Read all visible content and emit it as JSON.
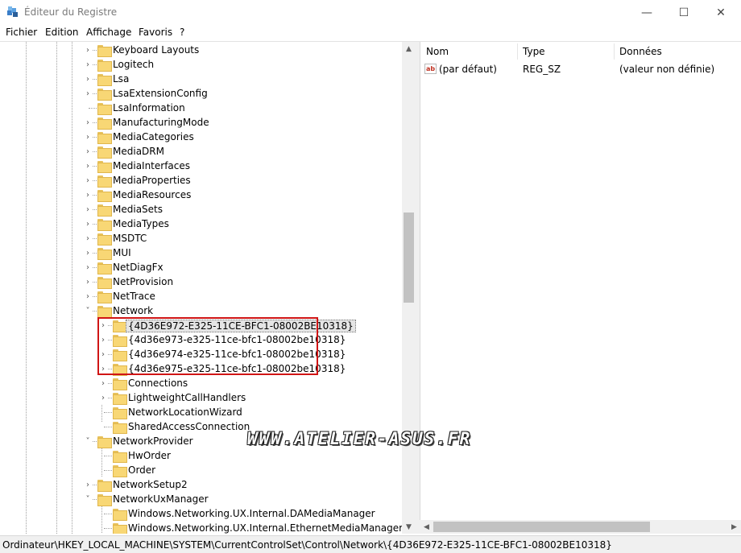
{
  "window": {
    "title": "Éditeur du Registre",
    "minimize_glyph": "—",
    "maximize_glyph": "☐",
    "close_glyph": "✕",
    "icon": "registry-icon"
  },
  "menu": [
    "Fichier",
    "Edition",
    "Affichage",
    "Favoris",
    "?"
  ],
  "tree": {
    "level1": [
      {
        "label": "Keyboard Layouts",
        "exp": "›"
      },
      {
        "label": "Logitech",
        "exp": "›"
      },
      {
        "label": "Lsa",
        "exp": "›"
      },
      {
        "label": "LsaExtensionConfig",
        "exp": "›"
      },
      {
        "label": "LsaInformation",
        "exp": ""
      },
      {
        "label": "ManufacturingMode",
        "exp": "›"
      },
      {
        "label": "MediaCategories",
        "exp": "›"
      },
      {
        "label": "MediaDRM",
        "exp": "›"
      },
      {
        "label": "MediaInterfaces",
        "exp": "›"
      },
      {
        "label": "MediaProperties",
        "exp": "›"
      },
      {
        "label": "MediaResources",
        "exp": "›"
      },
      {
        "label": "MediaSets",
        "exp": "›"
      },
      {
        "label": "MediaTypes",
        "exp": "›"
      },
      {
        "label": "MSDTC",
        "exp": "›"
      },
      {
        "label": "MUI",
        "exp": "›"
      },
      {
        "label": "NetDiagFx",
        "exp": "›"
      },
      {
        "label": "NetProvision",
        "exp": "›"
      },
      {
        "label": "NetTrace",
        "exp": "›"
      },
      {
        "label": "Network",
        "exp": "˅"
      }
    ],
    "network_children": [
      {
        "label": "{4D36E972-E325-11CE-BFC1-08002BE10318}",
        "exp": "›",
        "selected": true
      },
      {
        "label": "{4d36e973-e325-11ce-bfc1-08002be10318}",
        "exp": "›"
      },
      {
        "label": "{4d36e974-e325-11ce-bfc1-08002be10318}",
        "exp": "›"
      },
      {
        "label": "{4d36e975-e325-11ce-bfc1-08002be10318}",
        "exp": "›"
      },
      {
        "label": "Connections",
        "exp": "›"
      },
      {
        "label": "LightweightCallHandlers",
        "exp": "›"
      },
      {
        "label": "NetworkLocationWizard",
        "exp": ""
      },
      {
        "label": "SharedAccessConnection",
        "exp": ""
      }
    ],
    "network_provider": {
      "label": "NetworkProvider",
      "exp": "˅"
    },
    "provider_children": [
      {
        "label": "HwOrder",
        "exp": ""
      },
      {
        "label": "Order",
        "exp": ""
      }
    ],
    "network_setup2": {
      "label": "NetworkSetup2",
      "exp": "›"
    },
    "network_ux": {
      "label": "NetworkUxManager",
      "exp": "˅"
    },
    "ux_children": [
      {
        "label": "Windows.Networking.UX.Internal.DAMediaManager",
        "exp": ""
      },
      {
        "label": "Windows.Networking.UX.Internal.EthernetMediaManager",
        "exp": ""
      }
    ]
  },
  "values_table": {
    "headers": [
      "Nom",
      "Type",
      "Données"
    ],
    "rows": [
      {
        "icon": "reg-sz-icon",
        "icon_text": "ab",
        "name": "(par défaut)",
        "type": "REG_SZ",
        "data": "(valeur non définie)"
      }
    ]
  },
  "status_bar": {
    "path": "Ordinateur\\HKEY_LOCAL_MACHINE\\SYSTEM\\CurrentControlSet\\Control\\Network\\{4D36E972-E325-11CE-BFC1-08002BE10318}"
  },
  "watermark": "WWW.ATELIER-ASUS.FR",
  "colors": {
    "folder": "#f8d775",
    "highlight": "#d01515",
    "selection": "#e5e5e5"
  }
}
